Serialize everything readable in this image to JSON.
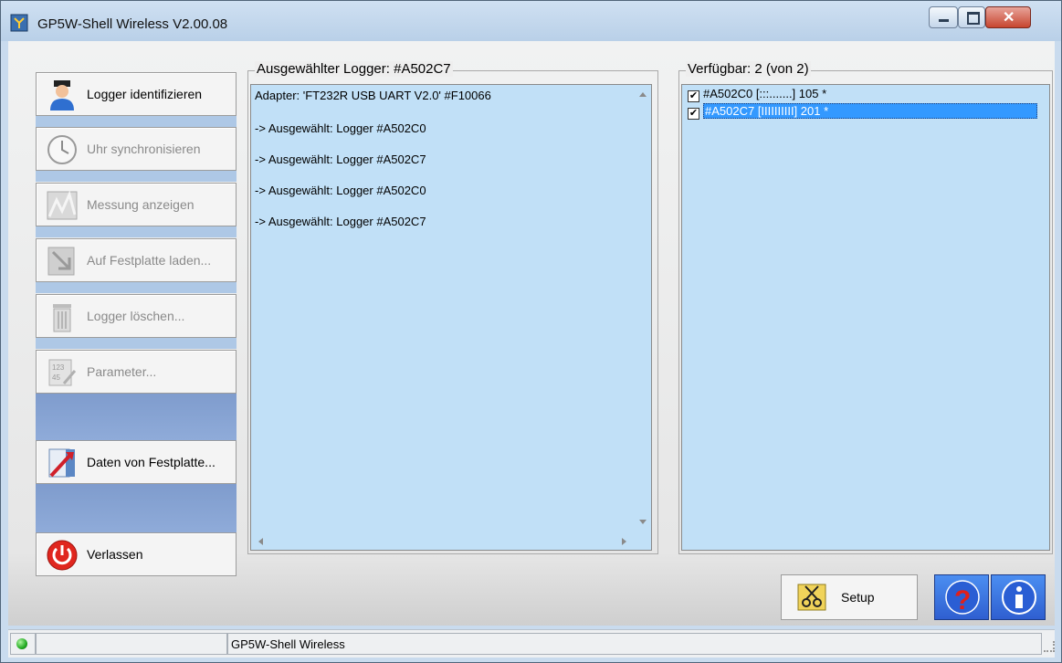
{
  "window": {
    "title": "GP5W-Shell Wireless V2.00.08",
    "controls": {
      "minimize": "minimize",
      "maximize": "maximize",
      "close": "close"
    }
  },
  "sidebar": {
    "buttons": [
      {
        "label": "Logger identifizieren",
        "mnemonic": "i",
        "enabled": true,
        "icon": "user-icon"
      },
      {
        "label": "Uhr synchronisieren",
        "mnemonic": "U",
        "enabled": false,
        "icon": "clock-icon"
      },
      {
        "label": "Messung anzeigen",
        "mnemonic": "M",
        "enabled": false,
        "icon": "chart-icon"
      },
      {
        "label": "Auf Festplatte laden...",
        "mnemonic": "A",
        "enabled": false,
        "icon": "download-icon"
      },
      {
        "label": "Logger löschen...",
        "mnemonic": "L",
        "enabled": false,
        "icon": "trash-icon"
      },
      {
        "label": "Parameter...",
        "mnemonic": "P",
        "enabled": false,
        "icon": "parameter-icon"
      },
      {
        "label": "Daten von Festplatte...",
        "mnemonic": "D",
        "enabled": true,
        "icon": "open-file-icon"
      },
      {
        "label": "Verlassen",
        "mnemonic": "V",
        "enabled": true,
        "icon": "power-icon"
      }
    ]
  },
  "log_panel": {
    "title": "Ausgewählter Logger: #A502C7",
    "lines": [
      "Adapter: 'FT232R USB UART V2.0' #F10066",
      "-> Ausgewählt: Logger #A502C0",
      "-> Ausgewählt: Logger #A502C7",
      "-> Ausgewählt: Logger #A502C0",
      "-> Ausgewählt: Logger #A502C7"
    ]
  },
  "available_panel": {
    "title": "Verfügbar: 2 (von 2)",
    "items": [
      {
        "text": "#A502C0 [:::.......] 105 *",
        "checked": true,
        "selected": false
      },
      {
        "text": "#A502C7 [IIIIIIIIII] 201 *",
        "checked": true,
        "selected": true
      }
    ]
  },
  "bottom": {
    "setup_label": "Setup",
    "setup_mnemonic": "S",
    "help_icon": "help-icon",
    "info_icon": "info-icon"
  },
  "statusbar": {
    "text": "GP5W-Shell Wireless",
    "led_color": "#22aa22"
  },
  "colors": {
    "list_bg": "#c1e0f7",
    "selection": "#3399ff",
    "accent_blue": "#2f5fd0"
  }
}
